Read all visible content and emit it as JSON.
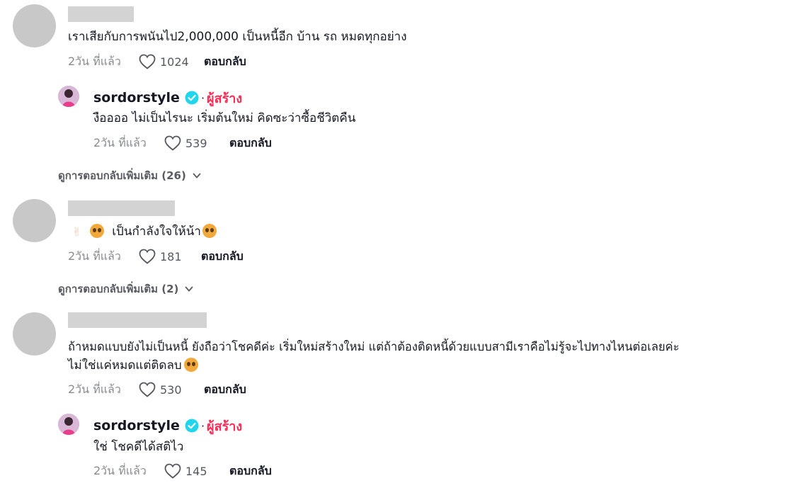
{
  "comments": [
    {
      "text": "เราเสียกับการพนันไป2,000,000 เป็นหนี้อีก บ้าน รถ หมดทุกอย่าง",
      "time": "2วัน ที่แล้ว",
      "likes": "1024",
      "reply_label": "ตอบกลับ",
      "creator_reply": {
        "username": "sordorstyle",
        "creator_tag": "ผู้สร้าง",
        "text": "งืออออ ไม่เป็นไรนะ เริ่มต้นใหม่ คิดซะว่าซื้อชีวิตคืน",
        "time": "2วัน ที่แล้ว",
        "likes": "539",
        "reply_label": "ตอบกลับ"
      },
      "more_replies": "ดูการตอบกลับเพิ่มเติม (26)"
    },
    {
      "text": "เป็นกำลังใจให้น้า",
      "time": "2วัน ที่แล้ว",
      "likes": "181",
      "reply_label": "ตอบกลับ",
      "more_replies": "ดูการตอบกลับเพิ่มเติม (2)"
    },
    {
      "text_line1": "ถ้าหมดแบบยังไม่เป็นหนี้ ยังถือว่าโชคดีค่ะ เริ่มใหม่สร้างใหม่ แต่ถ้าต้องติดหนี้ด้วยแบบสามีเราคือไม่รู้จะไปทางไหนต่อเลยค่ะ",
      "text_line2": "ไม่ใช่แค่หมดแต่ติดลบ",
      "time": "2วัน ที่แล้ว",
      "likes": "530",
      "reply_label": "ตอบกลับ",
      "creator_reply": {
        "username": "sordorstyle",
        "creator_tag": "ผู้สร้าง",
        "text": "ใช่ โชคดีได้สติไว",
        "time": "2วัน ที่แล้ว",
        "likes": "145",
        "reply_label": "ตอบกลับ"
      }
    }
  ],
  "icons": {
    "like": "heart-outline-icon",
    "verified": "verified-badge-icon",
    "chevron": "chevron-down-icon"
  },
  "colors": {
    "creator_tag": "#fe2c55",
    "verified": "#20d5ec",
    "avatar_placeholder": "#c8c8c8"
  }
}
